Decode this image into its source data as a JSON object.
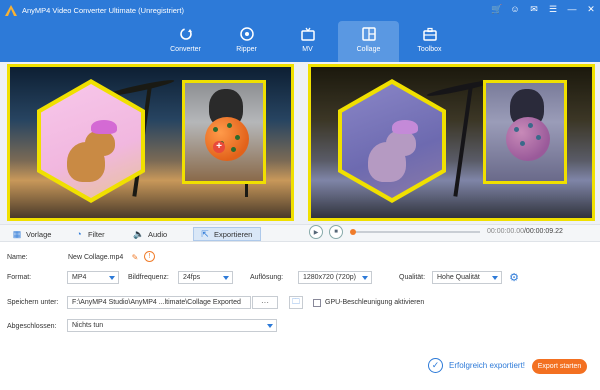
{
  "app": {
    "title": "AnyMP4 Video Converter Ultimate (Unregistriert)"
  },
  "window_controls": [
    "cart-icon",
    "user-icon",
    "chat-icon",
    "menu-icon",
    "minimize-icon",
    "close-icon"
  ],
  "nav": {
    "tabs": [
      {
        "label": "Converter",
        "icon": "refresh-icon",
        "active": false
      },
      {
        "label": "Ripper",
        "icon": "disc-icon",
        "active": false
      },
      {
        "label": "MV",
        "icon": "tv-icon",
        "active": false
      },
      {
        "label": "Collage",
        "icon": "collage-icon",
        "active": true
      },
      {
        "label": "Toolbox",
        "icon": "toolbox-icon",
        "active": false
      }
    ]
  },
  "bottom_tabs": [
    {
      "label": "Vorlage",
      "icon": "grid-icon",
      "active": false
    },
    {
      "label": "Filter",
      "icon": "filter-icon",
      "active": false
    },
    {
      "label": "Audio",
      "icon": "speaker-icon",
      "active": false
    },
    {
      "label": "Exportieren",
      "icon": "export-icon",
      "active": true
    }
  ],
  "player": {
    "time": "00:00:00.00/00:00:09.22",
    "current": "00:00:00.00",
    "total": "/00:00:09.22",
    "progress": 0.0
  },
  "settings": {
    "name_label": "Name:",
    "name_value": "New Collage.mp4",
    "format_label": "Format:",
    "format_value": "MP4",
    "fps_label": "Bildfrequenz:",
    "fps_value": "24fps",
    "resolution_label": "Auflösung:",
    "resolution_value": "1280x720 (720p)",
    "quality_label": "Qualität:",
    "quality_value": "Hohe Qualität",
    "save_label": "Speichern unter:",
    "save_path": "F:\\AnyMP4 Studio\\AnyMP4 ...ltimate\\Collage Exported",
    "browse_label": "···",
    "gpu_label": "GPU-Beschleunigung aktivieren",
    "done_label": "Abgeschlossen:",
    "done_value": "Nichts tun"
  },
  "status": {
    "success_text": "Erfolgreich exportiert!",
    "export_button": "Export starten"
  },
  "colors": {
    "accent": "#2d7ad8",
    "highlight": "#f0e000",
    "export": "#f37021"
  }
}
